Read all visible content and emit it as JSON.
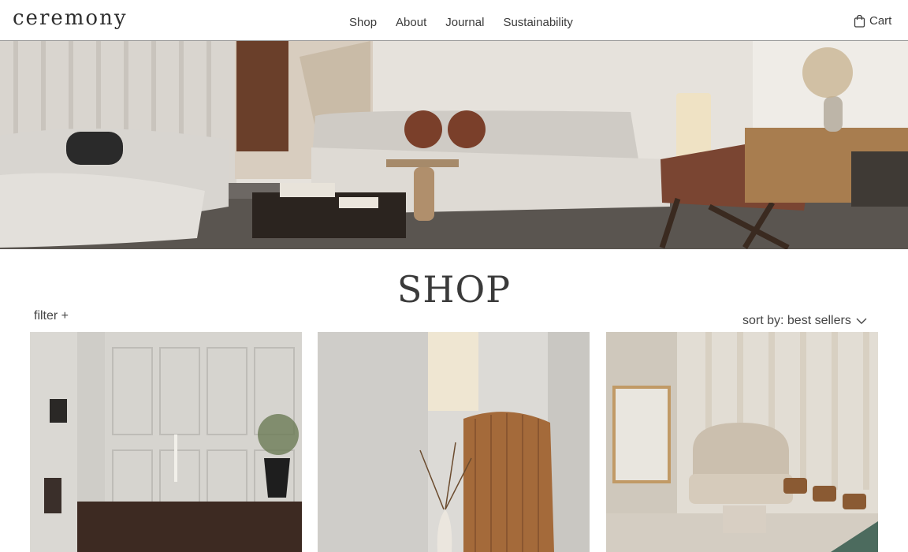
{
  "header": {
    "logo": "ceremony",
    "nav": [
      "Shop",
      "About",
      "Journal",
      "Sustainability"
    ],
    "cart_label": "Cart",
    "cart_icon": "shopping-bag-icon"
  },
  "hero": {
    "image": "living-room-hero",
    "arrow_icon": "arrow-down-right-icon"
  },
  "shop": {
    "title": "SHOP",
    "filter_label": "filter +",
    "sort_label": "sort by: best sellers",
    "sort_icon": "chevron-down-icon"
  },
  "products": [
    {
      "image": "dining-room-photo"
    },
    {
      "image": "wood-screen-photo"
    },
    {
      "image": "sofa-lounge-photo"
    }
  ],
  "colors": {
    "text": "#3a3a3a",
    "background": "#ffffff",
    "divider": "#9a9a9a"
  }
}
